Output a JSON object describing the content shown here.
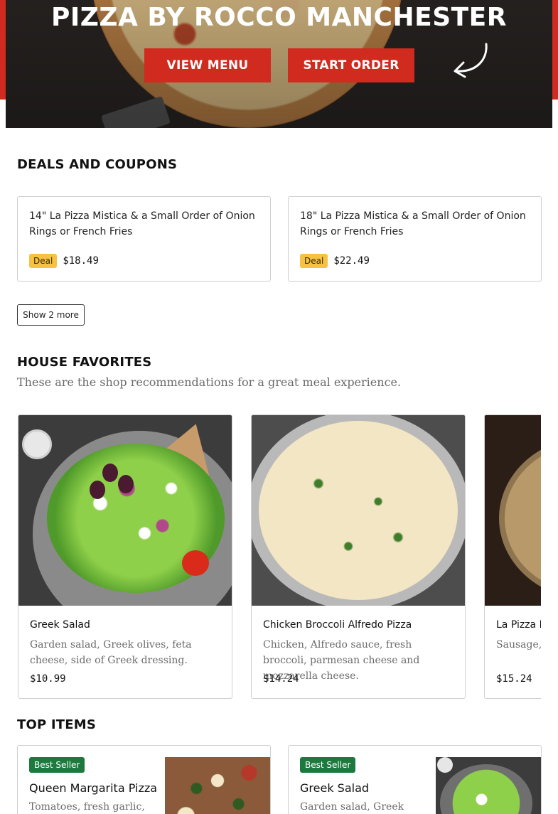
{
  "hero": {
    "title": "PIZZA BY ROCCO MANCHESTER",
    "view_menu_label": "VIEW MENU",
    "start_order_label": "START ORDER"
  },
  "deals": {
    "title": "DEALS AND COUPONS",
    "items": [
      {
        "name": "14\" La Pizza Mistica & a Small Order of Onion Rings or French Fries",
        "badge": "Deal",
        "price": "$18.49"
      },
      {
        "name": "18\" La Pizza Mistica & a Small Order of Onion Rings or French Fries",
        "badge": "Deal",
        "price": "$22.49"
      }
    ],
    "show_more_label": "Show 2 more"
  },
  "favorites": {
    "title": "HOUSE FAVORITES",
    "subtitle": "These are the shop recommendations for a great meal experience.",
    "items": [
      {
        "name": "Greek Salad",
        "description": "Garden salad, Greek olives, feta cheese, side of Greek dressing.",
        "price": "$10.99"
      },
      {
        "name": "Chicken Broccoli Alfredo Pizza",
        "description": "Chicken, Alfredo sauce, fresh broccoli, parmesan cheese and mozzarella cheese.",
        "price": "$14.24"
      },
      {
        "name": "La Pizza Mistica",
        "description": "Sausage, topped with",
        "price": "$15.24"
      }
    ]
  },
  "top_items": {
    "title": "TOP ITEMS",
    "items": [
      {
        "badge": "Best Seller",
        "name": "Queen Margarita Pizza",
        "description": "Tomatoes, fresh garlic,"
      },
      {
        "badge": "Best Seller",
        "name": "Greek Salad",
        "description": "Garden salad, Greek"
      }
    ]
  },
  "colors": {
    "brand_red": "#d12a1f",
    "deal_badge": "#f7c242",
    "best_seller_badge": "#1c7a3e"
  },
  "icons": [
    "curved-arrow-icon"
  ]
}
